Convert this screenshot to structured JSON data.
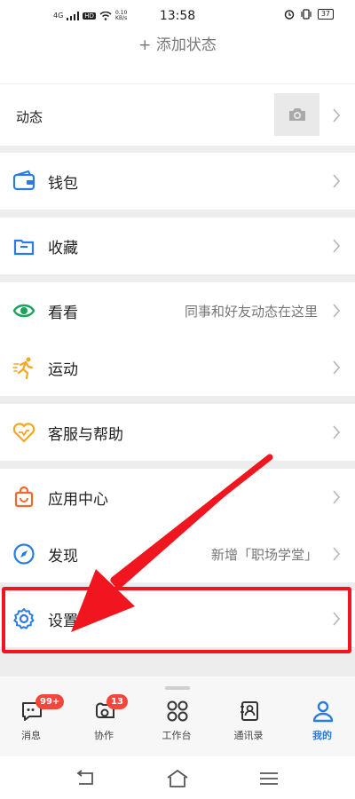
{
  "status_bar": {
    "network": "4G",
    "hd": "HD",
    "speed_value": "0.10",
    "speed_unit": "KB/s",
    "time": "13:58",
    "battery": "37"
  },
  "profile": {
    "add_status": "+ 添加状态"
  },
  "moments": {
    "label": "动态",
    "thumb_icon": "camera-icon"
  },
  "menu": {
    "wallet": "钱包",
    "favorites": "收藏",
    "kankan": "看看",
    "kankan_hint": "同事和好友动态在这里",
    "sports": "运动",
    "support": "客服与帮助",
    "app_center": "应用中心",
    "discover": "发现",
    "discover_hint": "新增「职场学堂」",
    "settings": "设置"
  },
  "tabs": {
    "messages": "消息",
    "messages_badge": "99+",
    "collab": "协作",
    "collab_badge": "13",
    "workbench": "工作台",
    "contacts": "通讯录",
    "me": "我的"
  },
  "colors": {
    "accent_blue": "#2a7ce0",
    "badge_red": "#f3473c",
    "highlight_red": "#f0151e"
  }
}
